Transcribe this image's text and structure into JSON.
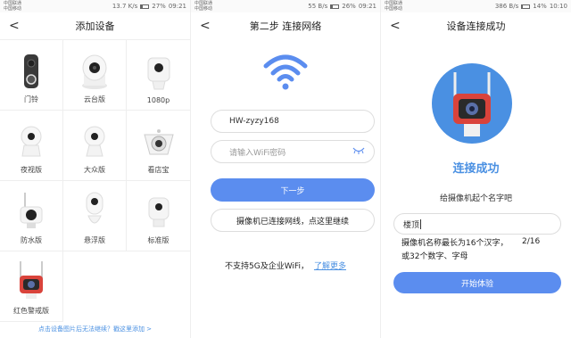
{
  "status_bars": [
    {
      "carrier1": "中国联通",
      "carrier2": "中国移动",
      "speed": "13.7 K/s",
      "battery": "27%",
      "battery_level": 0.27,
      "time": "09:21"
    },
    {
      "carrier1": "中国联通",
      "carrier2": "中国移动",
      "speed": "55 B/s",
      "battery": "26%",
      "battery_level": 0.26,
      "time": "09:21"
    },
    {
      "carrier1": "中国联通",
      "carrier2": "中国移动",
      "speed": "386 B/s",
      "battery": "14%",
      "battery_level": 0.14,
      "time": "10:10"
    }
  ],
  "screen1": {
    "title": "添加设备",
    "back": "<",
    "devices": [
      {
        "label": "门铃",
        "icon": "doorbell-icon"
      },
      {
        "label": "云台版",
        "icon": "ptz-camera-icon"
      },
      {
        "label": "1080p",
        "icon": "camera-1080p-icon"
      },
      {
        "label": "夜视版",
        "icon": "night-camera-icon"
      },
      {
        "label": "大众版",
        "icon": "standard-camera-icon"
      },
      {
        "label": "看店宝",
        "icon": "ceiling-camera-icon"
      },
      {
        "label": "防水版",
        "icon": "waterproof-camera-icon"
      },
      {
        "label": "悬浮版",
        "icon": "floating-camera-icon"
      },
      {
        "label": "标准版",
        "icon": "basic-camera-icon"
      },
      {
        "label": "红色警戒版",
        "icon": "red-alert-camera-icon"
      }
    ],
    "footer": "点击设备图片后无法继续？戳这里添加 >"
  },
  "screen2": {
    "title": "第二步 连接网络",
    "back": "<",
    "ssid": "HW-zyzy168",
    "password_placeholder": "请输入WiFi密码",
    "next_button": "下一步",
    "continue_button": "摄像机已连接网线，点这里继续",
    "note": "不支持5G及企业WiFi，",
    "learn_more": "了解更多"
  },
  "screen3": {
    "title": "设备连接成功",
    "back": "<",
    "success": "连接成功",
    "prompt": "给摄像机起个名字吧",
    "name_value": "楼顶",
    "rule": "摄像机名称最长为16个汉字，或32个数字、字母",
    "counter": "2/16",
    "start_button": "开始体验"
  },
  "colors": {
    "accent": "#5b8def",
    "link": "#4a90e2"
  }
}
